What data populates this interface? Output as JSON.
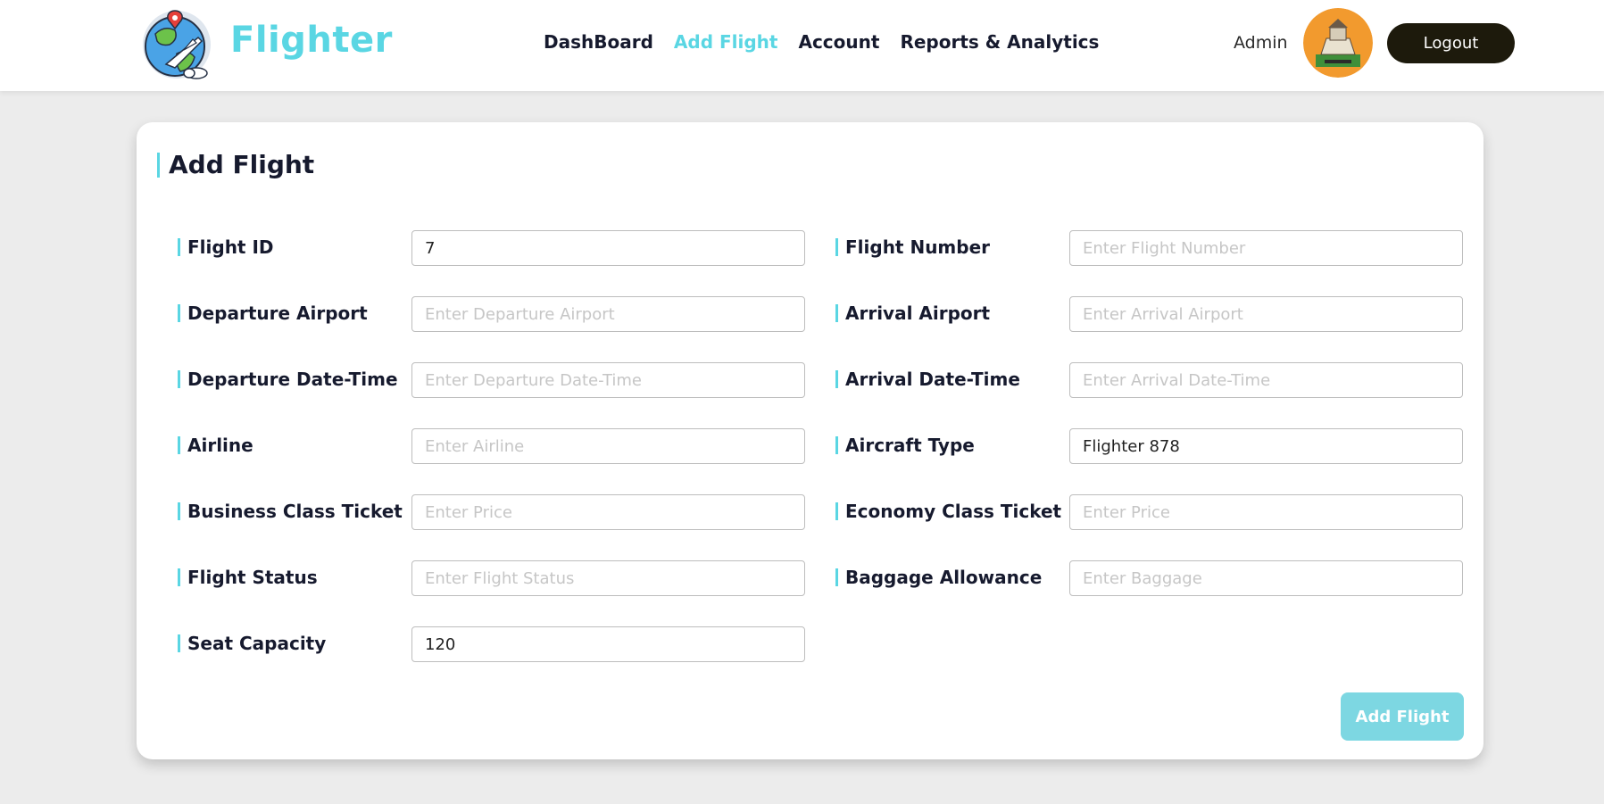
{
  "header": {
    "brand": "Flighter",
    "nav": [
      {
        "label": "DashBoard",
        "active": false
      },
      {
        "label": "Add Flight",
        "active": true
      },
      {
        "label": "Account",
        "active": false
      },
      {
        "label": "Reports & Analytics",
        "active": false
      }
    ],
    "user_label": "Admin",
    "logout_label": "Logout"
  },
  "form": {
    "title": "Add Flight",
    "fields": [
      {
        "label": "Flight ID",
        "value": "7",
        "placeholder": ""
      },
      {
        "label": "Flight Number",
        "value": "",
        "placeholder": "Enter Flight Number"
      },
      {
        "label": "Departure Airport",
        "value": "",
        "placeholder": "Enter Departure Airport"
      },
      {
        "label": "Arrival Airport",
        "value": "",
        "placeholder": "Enter Arrival Airport"
      },
      {
        "label": "Departure Date-Time",
        "value": "",
        "placeholder": "Enter Departure Date-Time"
      },
      {
        "label": "Arrival Date-Time",
        "value": "",
        "placeholder": "Enter Arrival Date-Time"
      },
      {
        "label": "Airline",
        "value": "",
        "placeholder": "Enter Airline"
      },
      {
        "label": "Aircraft Type",
        "value": "Flighter 878",
        "placeholder": ""
      },
      {
        "label": "Business Class Ticket",
        "value": "",
        "placeholder": "Enter Price"
      },
      {
        "label": "Economy Class Ticket",
        "value": "",
        "placeholder": "Enter Price"
      },
      {
        "label": "Flight Status",
        "value": "",
        "placeholder": "Enter Flight Status"
      },
      {
        "label": "Baggage Allowance",
        "value": "",
        "placeholder": "Enter Baggage"
      },
      {
        "label": "Seat Capacity",
        "value": "120",
        "placeholder": ""
      }
    ],
    "submit_label": "Add Flight"
  },
  "colors": {
    "accent": "#5ad6e3",
    "logout_bg": "#1d1a0c",
    "submit_bg": "#7dd7e2",
    "page_bg": "#ececec"
  },
  "icons": {
    "logo": "globe-plane-logo-icon",
    "avatar": "user-avatar"
  }
}
